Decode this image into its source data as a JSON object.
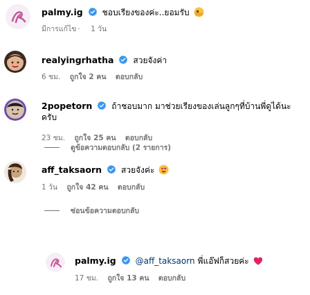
{
  "comments": [
    {
      "user": "palmy.ig",
      "text": "ชอบเรียงของค่ะ..ยอมรับ",
      "emoji": "peeking-face",
      "edited": "มีการแก้ไข",
      "time": "1 วัน"
    },
    {
      "user": "realyingrhatha",
      "text": "สวยจังค่า",
      "time": "6 ชม.",
      "likes": "ถูกใจ 2 คน",
      "reply": "ตอบกลับ"
    },
    {
      "user": "2popetorn",
      "text": "ถ้าชอบมาก มาช่วยเรียงของเล่นลูกๆที่บ้านพี่ดูได้นะครับ",
      "time": "23 ชม.",
      "likes": "ถูกใจ 25 คน",
      "reply": "ตอบกลับ",
      "thread": "ดูข้อความตอบกลับ (2 รายการ)"
    },
    {
      "user": "aff_taksaorn",
      "text": "สวยจังค่ะ",
      "emoji": "smiling-heart-eyes-face",
      "time": "1 วัน",
      "likes": "ถูกใจ 42 คน",
      "reply": "ตอบกลับ",
      "thread": "ซ่อนข้อความตอบกลับ"
    },
    {
      "user": "palmy.ig",
      "mention": "@aff_taksaorn",
      "text": "พี่แอ๊ฟก็สวยค่ะ",
      "emoji": "red-heart",
      "time": "17 ชม.",
      "likes": "ถูกใจ 13 คน",
      "reply": "ตอบกลับ"
    }
  ],
  "colors": {
    "verified": "#3897f0",
    "meta": "#737373",
    "heart": "#e0245e"
  }
}
